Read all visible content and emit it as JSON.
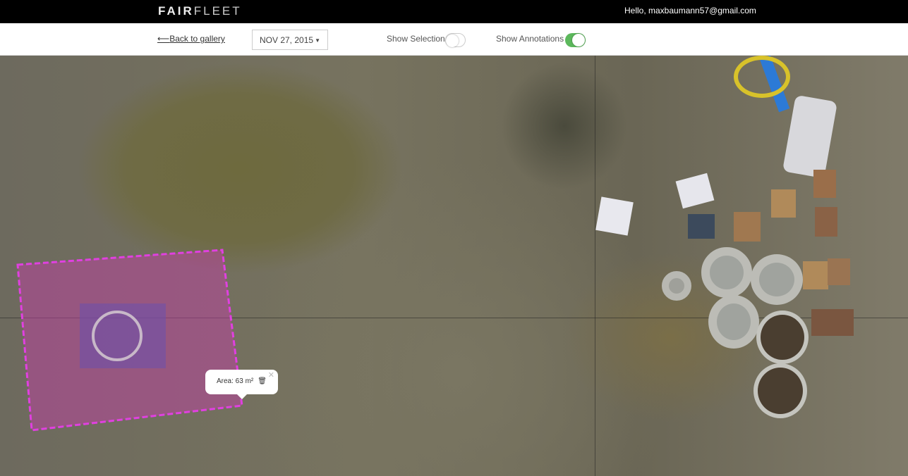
{
  "header": {
    "logo_bold": "FAIR",
    "logo_light": "FLEET",
    "greeting": "Hello, maxbaumann57@gmail.com"
  },
  "toolbar": {
    "back_label": "Back to gallery",
    "date": "NOV 27, 2015",
    "show_selection_label": "Show Selection",
    "show_selection_on": false,
    "show_annotations_label": "Show Annotations",
    "show_annotations_on": true
  },
  "colors": {
    "toggle_on": "#5cb85c",
    "annotation": "#e040e0"
  },
  "annotation": {
    "area_label": "Area: 63 m²"
  }
}
